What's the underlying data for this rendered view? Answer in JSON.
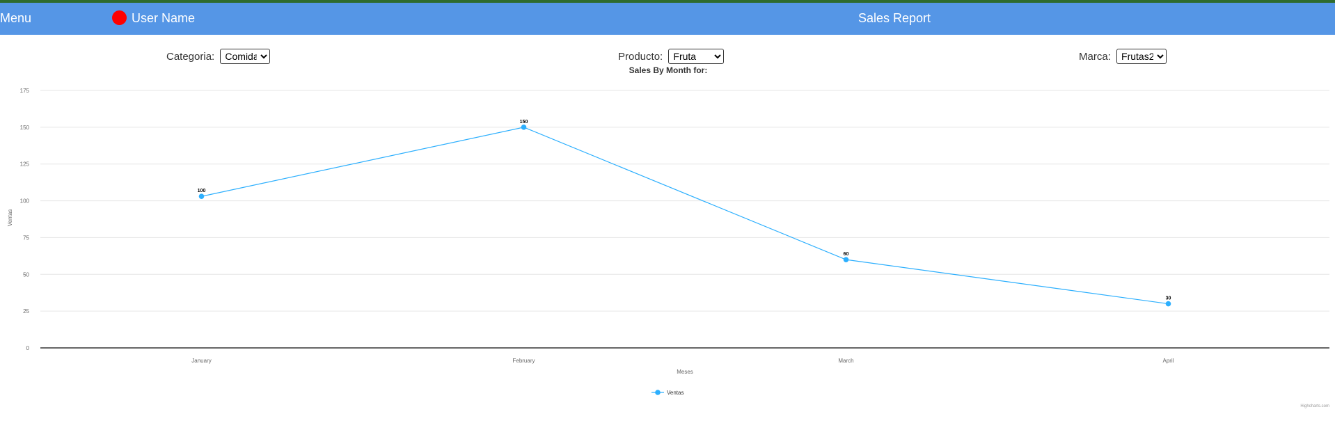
{
  "header": {
    "menu_label": "Menu",
    "user_name": "User Name",
    "report_title": "Sales Report",
    "avatar_color": "#ff0000",
    "bar_color": "#5596e6"
  },
  "filters": {
    "categoria": {
      "label": "Categoria:",
      "value": "Comida"
    },
    "producto": {
      "label": "Producto:",
      "value": "Fruta"
    },
    "marca": {
      "label": "Marca:",
      "value": "Frutas2"
    }
  },
  "chart_data": {
    "type": "line",
    "title": "Sales By Month for:",
    "xlabel": "Meses",
    "ylabel": "Ventas",
    "categories": [
      "January",
      "February",
      "March",
      "April"
    ],
    "series": [
      {
        "name": "Ventas",
        "values": [
          103,
          150,
          60,
          30
        ],
        "data_labels": [
          "100",
          "150",
          "60",
          "30"
        ],
        "color": "#2caffe"
      }
    ],
    "ylim": [
      0,
      175
    ],
    "yticks": [
      0,
      25,
      50,
      75,
      100,
      125,
      150,
      175
    ],
    "grid": true,
    "legend": "bottom-center",
    "credits": "Highcharts.com"
  }
}
